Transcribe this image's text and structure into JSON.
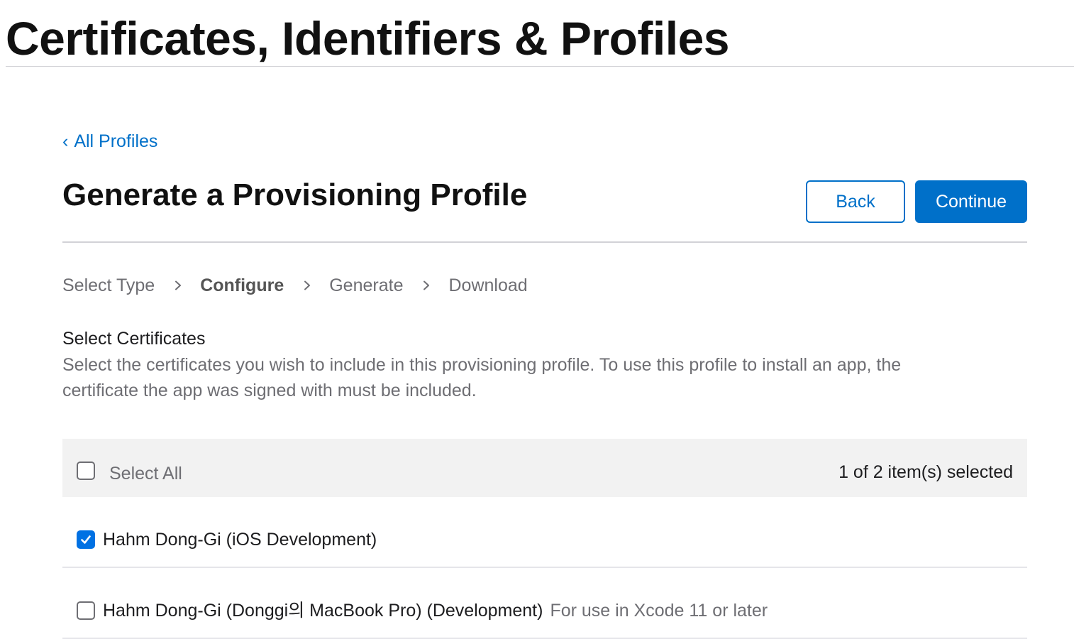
{
  "header": {
    "title": "Certificates, Identifiers & Profiles"
  },
  "nav": {
    "back_link": "All Profiles"
  },
  "page": {
    "title": "Generate a Provisioning Profile",
    "back_button": "Back",
    "continue_button": "Continue"
  },
  "steps": [
    {
      "label": "Select Type",
      "active": false
    },
    {
      "label": "Configure",
      "active": true
    },
    {
      "label": "Generate",
      "active": false
    },
    {
      "label": "Download",
      "active": false
    }
  ],
  "section": {
    "title": "Select Certificates",
    "description": "Select the certificates you wish to include in this provisioning profile. To use this profile to install an app, the certificate the app was signed with must be included."
  },
  "table": {
    "select_all_label": "Select All",
    "select_all_checked": false,
    "selected_count": "1 of 2 item(s) selected",
    "rows": [
      {
        "label": "Hahm Dong-Gi (iOS Development)",
        "note": "",
        "checked": true
      },
      {
        "label": "Hahm Dong-Gi (Donggi의 MacBook Pro) (Development)",
        "note": "For use in Xcode 11 or later",
        "checked": false
      }
    ]
  },
  "colors": {
    "accent": "#0070c9",
    "checkbox_checked": "#0071e3",
    "header_band": "#f2f2f2",
    "muted_text": "#6e6e73"
  },
  "icons": {
    "back_link": "chevron-left-icon",
    "step_separator": "chevron-right-icon",
    "checkbox_check": "checkmark-icon"
  }
}
